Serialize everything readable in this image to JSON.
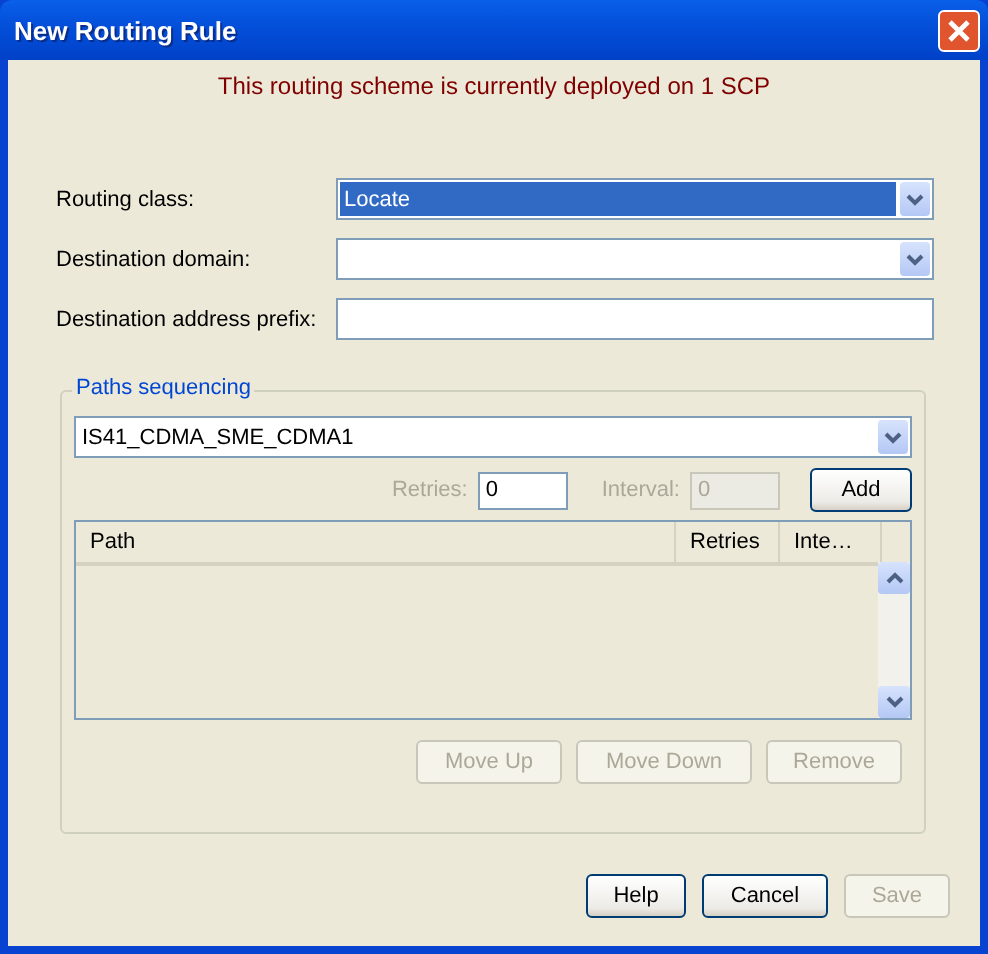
{
  "window": {
    "title": "New Routing Rule"
  },
  "notice": "This routing scheme is currently deployed on 1 SCP",
  "fields": [
    {
      "kind": "combo",
      "label": "Routing class:",
      "value": "Locate",
      "selected": true
    },
    {
      "kind": "combo",
      "label": "Destination domain:",
      "selected": false
    },
    {
      "kind": "text",
      "label": "Destination address prefix:"
    }
  ],
  "paths_group": {
    "title": "Paths sequencing",
    "path_combo": {
      "value": "IS41_CDMA_SME_CDMA1"
    },
    "inputs": [
      {
        "label": "Retries:",
        "value": "0",
        "disabled": false
      },
      {
        "label": "Interval:",
        "value": "0",
        "disabled": true
      }
    ],
    "add_button": {
      "label": "Add",
      "disabled": false
    },
    "table": {
      "columns": [
        "Path",
        "Retries",
        "Inte…"
      ]
    },
    "buttons": [
      {
        "label": "Move Up",
        "disabled": true
      },
      {
        "label": "Move Down",
        "disabled": true
      },
      {
        "label": "Remove",
        "disabled": true
      }
    ]
  },
  "buttons": [
    {
      "label": "Help",
      "disabled": false
    },
    {
      "label": "Cancel",
      "disabled": false
    },
    {
      "label": "Save",
      "disabled": true
    }
  ]
}
